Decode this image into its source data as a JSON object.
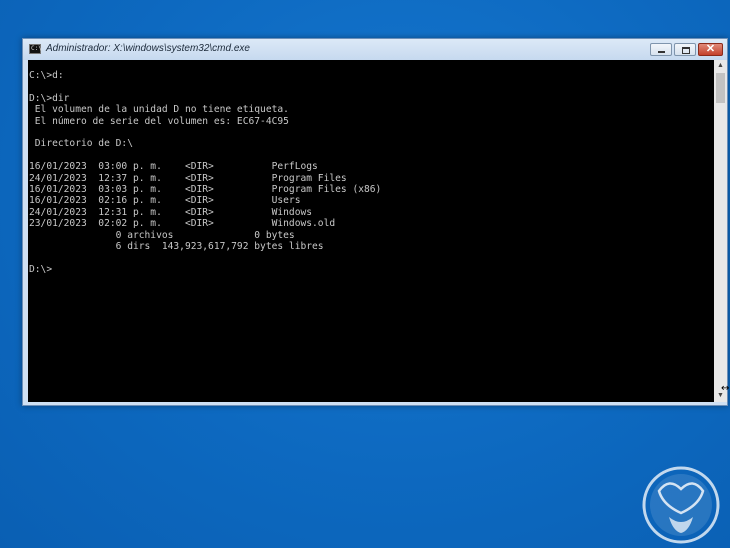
{
  "window": {
    "title": "Administrador: X:\\windows\\system32\\cmd.exe",
    "icon": "cmd-icon",
    "controls": {
      "minimize": "minimize-icon",
      "maximize": "maximize-icon",
      "close": "✕"
    }
  },
  "console": {
    "lines": [
      "C:\\>d:",
      "",
      "D:\\>dir",
      " El volumen de la unidad D no tiene etiqueta.",
      " El número de serie del volumen es: EC67-4C95",
      "",
      " Directorio de D:\\",
      "",
      "16/01/2023  03:00 p. m.    <DIR>          PerfLogs",
      "24/01/2023  12:37 p. m.    <DIR>          Program Files",
      "16/01/2023  03:03 p. m.    <DIR>          Program Files (x86)",
      "16/01/2023  02:16 p. m.    <DIR>          Users",
      "24/01/2023  12:31 p. m.    <DIR>          Windows",
      "23/01/2023  02:02 p. m.    <DIR>          Windows.old",
      "               0 archivos              0 bytes",
      "               6 dirs  143,923,617,792 bytes libres",
      "",
      "D:\\>"
    ]
  },
  "colors": {
    "desktop": "#0b6ec7",
    "console_bg": "#000000",
    "console_text": "#c8c8c8"
  }
}
